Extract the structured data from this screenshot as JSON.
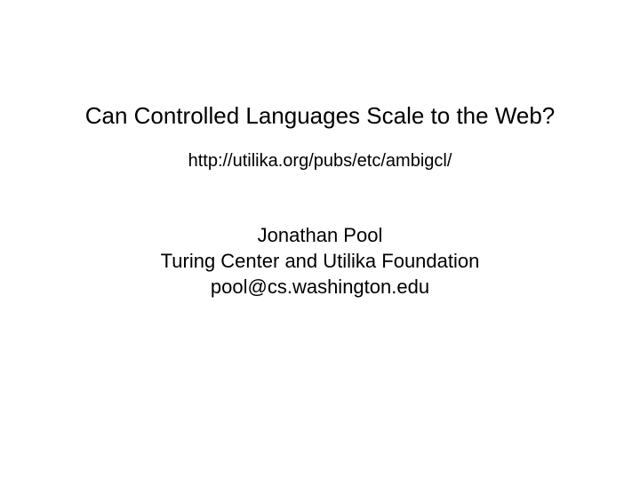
{
  "slide": {
    "title": "Can Controlled Languages Scale to the Web?",
    "url": "http://utilika.org/pubs/etc/ambigcl/",
    "author": {
      "name": "Jonathan Pool",
      "affiliation": "Turing Center and Utilika Foundation",
      "email": "pool@cs.washington.edu"
    }
  }
}
